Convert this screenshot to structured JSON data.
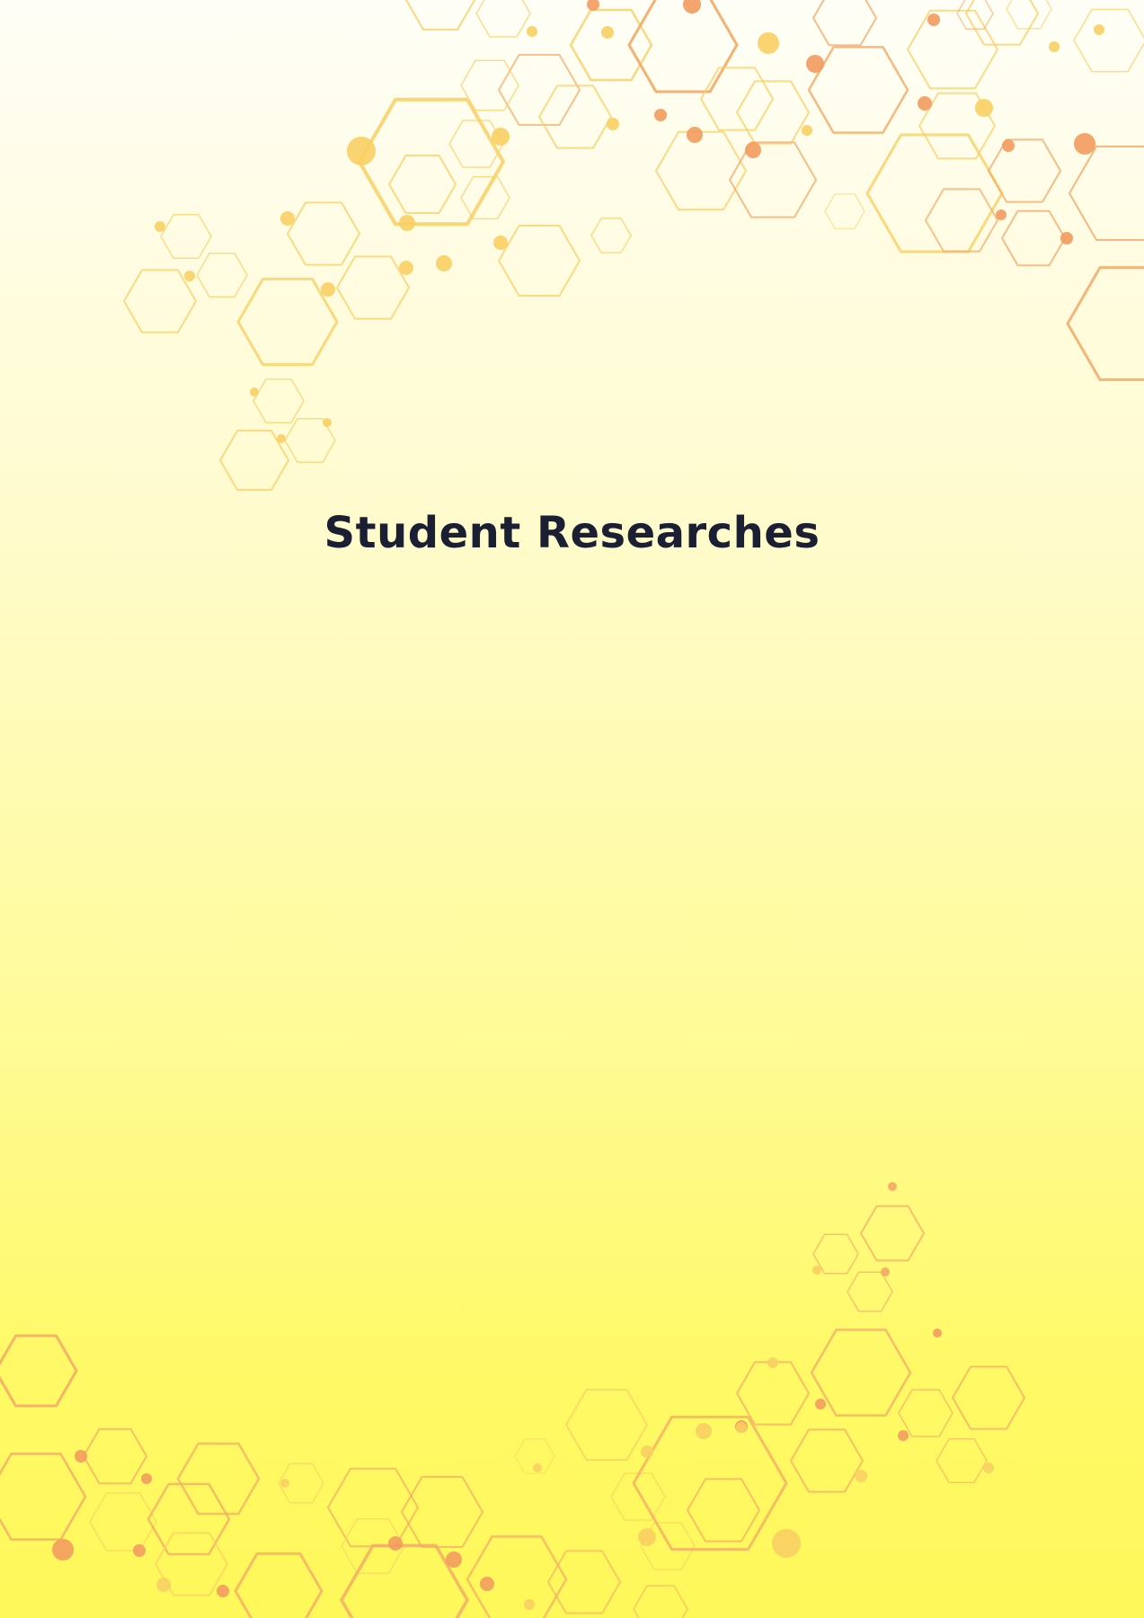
{
  "document": {
    "title": "Student Researches"
  },
  "colors": {
    "title": "#1b1f33",
    "hex_yellow": "#f8cf63",
    "hex_orange": "#f3a865",
    "hex_orange_dark": "#f39b5e",
    "background_top": "#fffef6",
    "background_bottom": "#fff85a"
  },
  "decoration": {
    "motif": "hexagon-network"
  }
}
